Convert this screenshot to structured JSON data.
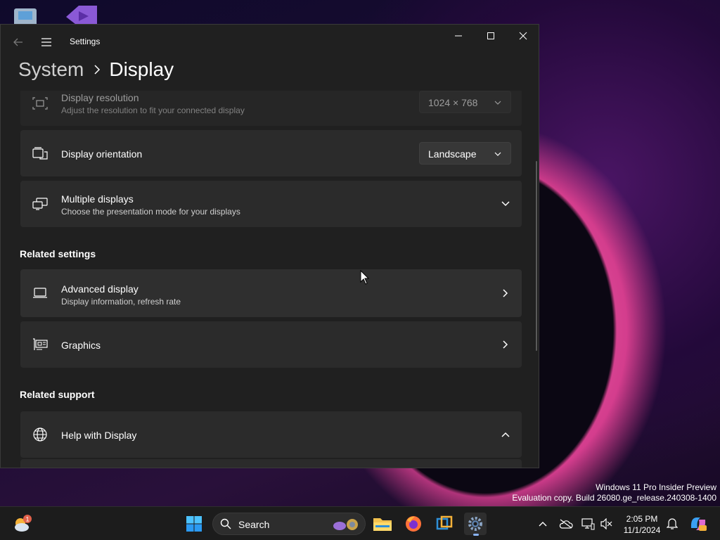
{
  "window": {
    "app_title": "Settings",
    "breadcrumb_parent": "System",
    "breadcrumb_current": "Display"
  },
  "cards": {
    "resolution": {
      "title": "Display resolution",
      "subtitle": "Adjust the resolution to fit your connected display",
      "value": "1024 × 768"
    },
    "orientation": {
      "title": "Display orientation",
      "value": "Landscape"
    },
    "multiple": {
      "title": "Multiple displays",
      "subtitle": "Choose the presentation mode for your displays"
    },
    "advanced": {
      "title": "Advanced display",
      "subtitle": "Display information, refresh rate"
    },
    "graphics": {
      "title": "Graphics"
    },
    "help": {
      "title": "Help with Display"
    }
  },
  "sections": {
    "related_settings": "Related settings",
    "related_support": "Related support"
  },
  "watermark": {
    "line1": "Windows 11 Pro Insider Preview",
    "line2": "Evaluation copy. Build 26080.ge_release.240308-1400"
  },
  "taskbar": {
    "search_label": "Search",
    "weather_badge": "1",
    "time": "2:05 PM",
    "date": "11/1/2024",
    "icons": [
      "weather-icon",
      "start-icon",
      "file-explorer-icon",
      "firefox-icon",
      "virtualbox-icon",
      "settings-app-icon",
      "chevron-up-icon",
      "onedrive-icon",
      "network-icon",
      "volume-mute-icon",
      "bell-icon",
      "copilot-icon"
    ]
  },
  "colors": {
    "window_bg": "#202020",
    "card_bg": "#2b2b2b",
    "accent": "#8ab4f8"
  }
}
